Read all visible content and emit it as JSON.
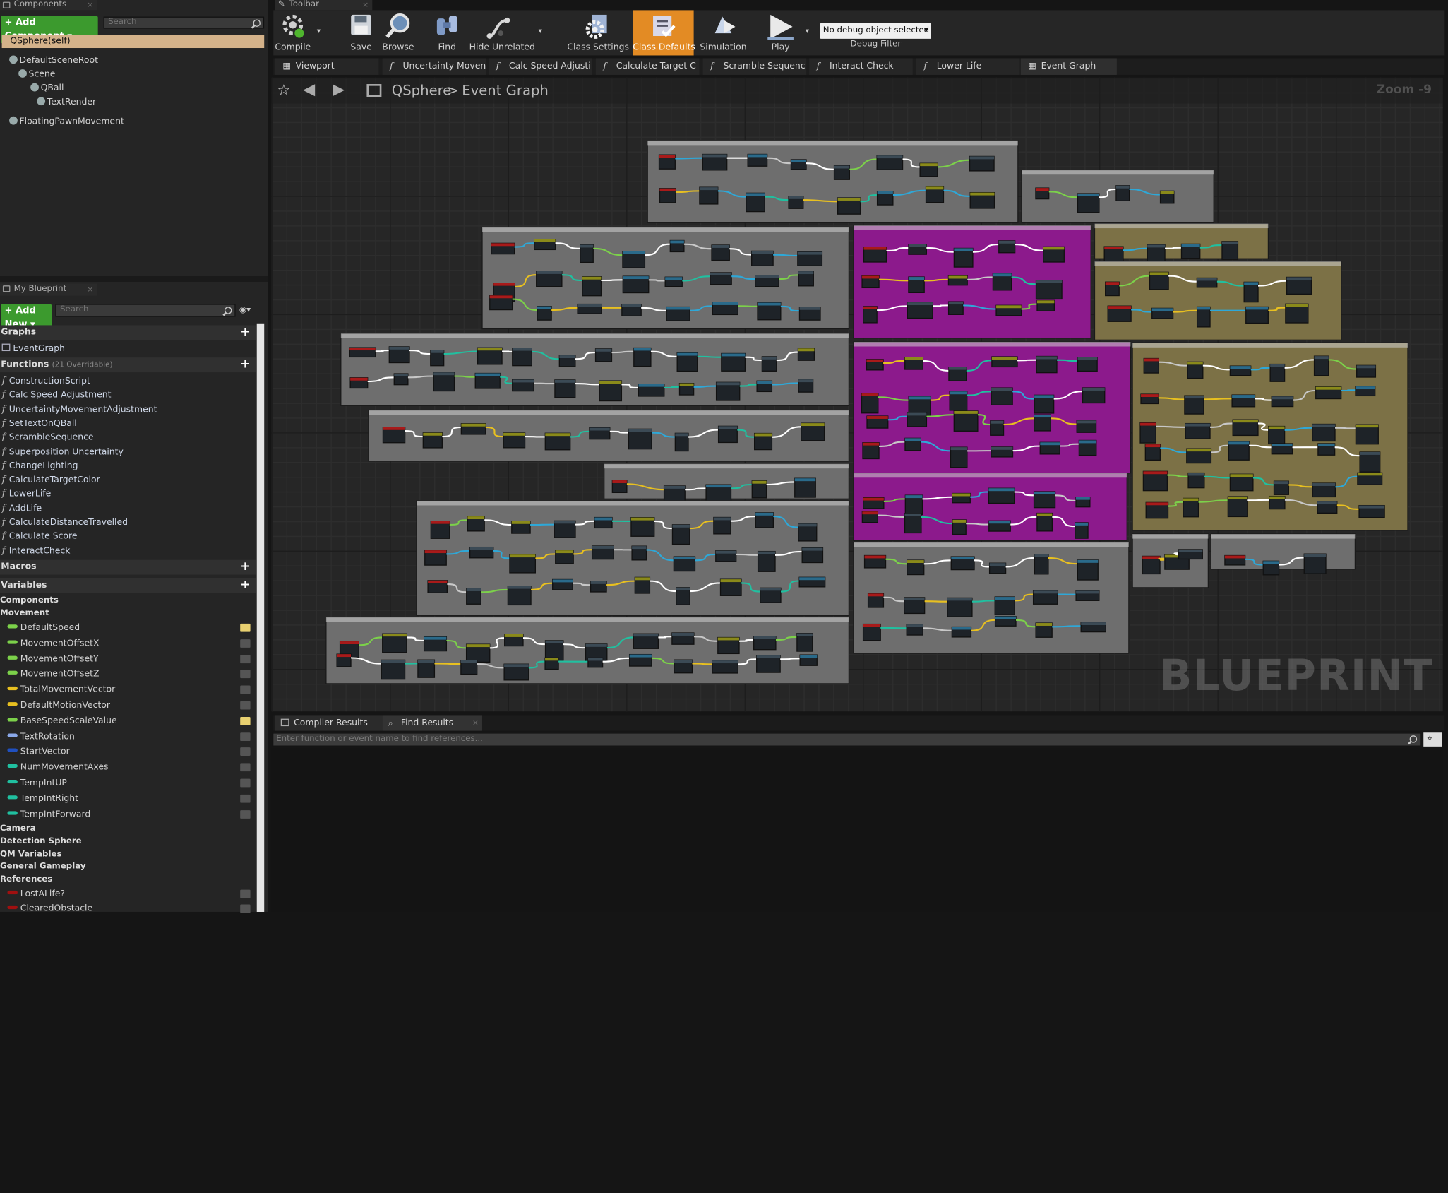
{
  "components": {
    "tab": "Components",
    "add_button": "+ Add Component ▾",
    "search_placeholder": "Search",
    "self_label": "QSphere(self)",
    "tree": [
      "DefaultSceneRoot",
      "Scene",
      "QBall",
      "TextRender",
      "FloatingPawnMovement"
    ]
  },
  "toolbar": {
    "tab": "Toolbar",
    "buttons": [
      "Compile",
      "Save",
      "Browse",
      "Find",
      "Hide Unrelated",
      "Class Settings",
      "Class Defaults",
      "Simulation",
      "Play"
    ],
    "debug_value": "No debug object selected",
    "debug_label": "Debug Filter"
  },
  "graph_tabs": [
    "Viewport",
    "Uncertainty Moven",
    "Calc Speed Adjusti",
    "Calculate Target C",
    "Scramble Sequenc",
    "Interact Check",
    "Lower Life",
    "Event Graph"
  ],
  "breadcrumb": {
    "class": "QSphere",
    "separator": ">",
    "graph": "Event Graph"
  },
  "zoom": "Zoom -9",
  "watermark": "BLUEPRINT",
  "my_blueprint": {
    "tab": "My Blueprint",
    "add_new": "+ Add New ▾",
    "search_placeholder": "Search",
    "graphs_header": "Graphs",
    "graphs": [
      "EventGraph"
    ],
    "functions_header": "Functions",
    "functions_note": "(21 Overridable)",
    "functions": [
      "ConstructionScript",
      "Calc Speed Adjustment",
      "UncertaintyMovementAdjustment",
      "SetTextOnQBall",
      "ScrambleSequence",
      "Superposition Uncertainty",
      "ChangeLighting",
      "CalculateTargetColor",
      "LowerLife",
      "AddLife",
      "CalculateDistanceTravelled",
      "Calculate Score",
      "InteractCheck"
    ],
    "macros_header": "Macros",
    "variables_header": "Variables",
    "cat_components": "Components",
    "cat_movement": "Movement",
    "movement_vars": [
      {
        "name": "DefaultSpeed",
        "color": "#7cd14a",
        "eye": true
      },
      {
        "name": "MovementOffsetX",
        "color": "#7cd14a",
        "eye": false
      },
      {
        "name": "MovementOffsetY",
        "color": "#7cd14a",
        "eye": false
      },
      {
        "name": "MovementOffsetZ",
        "color": "#7cd14a",
        "eye": false
      },
      {
        "name": "TotalMovementVector",
        "color": "#e8c020",
        "eye": false
      },
      {
        "name": "DefaultMotionVector",
        "color": "#e8c020",
        "eye": false
      },
      {
        "name": "BaseSpeedScaleValue",
        "color": "#7cd14a",
        "eye": true
      },
      {
        "name": "TextRotation",
        "color": "#8aa8e8",
        "eye": false
      },
      {
        "name": "StartVector",
        "color": "#2050c0",
        "eye": false
      },
      {
        "name": "NumMovementAxes",
        "color": "#20c0a0",
        "eye": false
      },
      {
        "name": "TempIntUP",
        "color": "#20c0a0",
        "eye": false
      },
      {
        "name": "TempIntRight",
        "color": "#20c0a0",
        "eye": false
      },
      {
        "name": "TempIntForward",
        "color": "#20c0a0",
        "eye": false
      }
    ],
    "categories": [
      "Camera",
      "Detection Sphere",
      "QM Variables",
      "General Gameplay",
      "References"
    ],
    "reference_vars": [
      {
        "name": "LostALife?",
        "color": "#a01010",
        "eye": false
      },
      {
        "name": "ClearedObstacle",
        "color": "#a01010",
        "eye": false
      }
    ]
  },
  "bottom": {
    "tabs": [
      "Compiler Results",
      "Find Results"
    ],
    "find_placeholder": "Enter function or event name to find references..."
  }
}
